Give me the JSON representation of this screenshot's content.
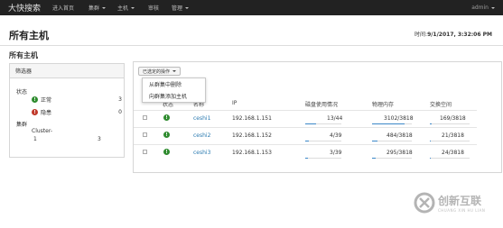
{
  "nav": {
    "brand": "大快搜索",
    "items": [
      {
        "label": "进入首页",
        "dropdown": false
      },
      {
        "label": "集群",
        "dropdown": true
      },
      {
        "label": "主机",
        "dropdown": true
      },
      {
        "label": "审核",
        "dropdown": false
      },
      {
        "label": "管理",
        "dropdown": true
      }
    ],
    "user": "admin"
  },
  "header": {
    "title": "所有主机",
    "time_label": "时间:",
    "time_value": "9/1/2017, 3:32:06 PM"
  },
  "section_title": "所有主机",
  "filter": {
    "title": "筛选器",
    "status_label": "状态",
    "status_items": [
      {
        "icon": "ok-circle-icon",
        "label": "正常",
        "count": "3"
      },
      {
        "icon": "alert-circle-icon",
        "label": "隐患",
        "count": "0"
      }
    ],
    "cluster_label": "集群",
    "cluster_name": "Cluster-",
    "cluster_number": "1",
    "cluster_count": "3"
  },
  "actions": {
    "button_label": "已选定的操作",
    "menu": [
      "从群集中删除",
      "向群集添加主机"
    ]
  },
  "table": {
    "headers": {
      "status": "状态",
      "name": "名称",
      "ip": "IP",
      "disk": "磁盘使用情况",
      "memory": "物理内存",
      "swap": "交换空间"
    },
    "rows": [
      {
        "name": "ceshi1",
        "ip": "192.168.1.151",
        "disk": "13/44",
        "disk_frac": 0.3,
        "memory": "3102/3818",
        "memory_frac": 0.81,
        "swap": "169/3818",
        "swap_frac": 0.04
      },
      {
        "name": "ceshi2",
        "ip": "192.168.1.152",
        "disk": "4/39",
        "disk_frac": 0.1,
        "memory": "484/3818",
        "memory_frac": 0.13,
        "swap": "21/3818",
        "swap_frac": 0.01
      },
      {
        "name": "ceshi3",
        "ip": "192.168.1.153",
        "disk": "3/39",
        "disk_frac": 0.08,
        "memory": "295/3818",
        "memory_frac": 0.08,
        "swap": "24/3818",
        "swap_frac": 0.01
      }
    ]
  },
  "watermark": {
    "text": "创新互联",
    "subtext": "CHUANG XIN HU LIAN"
  },
  "colors": {
    "nav_bg": "#222222",
    "link": "#2a7ab0",
    "ok": "#2e8b2e",
    "alert": "#c0392b",
    "progress": "#3a87c8"
  }
}
